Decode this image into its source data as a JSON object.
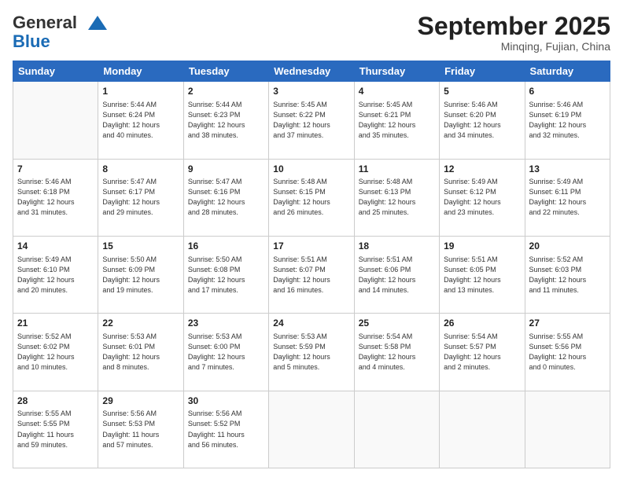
{
  "header": {
    "logo_line1": "General",
    "logo_line2": "Blue",
    "month": "September 2025",
    "location": "Minqing, Fujian, China"
  },
  "weekdays": [
    "Sunday",
    "Monday",
    "Tuesday",
    "Wednesday",
    "Thursday",
    "Friday",
    "Saturday"
  ],
  "weeks": [
    [
      {
        "day": "",
        "info": ""
      },
      {
        "day": "1",
        "info": "Sunrise: 5:44 AM\nSunset: 6:24 PM\nDaylight: 12 hours\nand 40 minutes."
      },
      {
        "day": "2",
        "info": "Sunrise: 5:44 AM\nSunset: 6:23 PM\nDaylight: 12 hours\nand 38 minutes."
      },
      {
        "day": "3",
        "info": "Sunrise: 5:45 AM\nSunset: 6:22 PM\nDaylight: 12 hours\nand 37 minutes."
      },
      {
        "day": "4",
        "info": "Sunrise: 5:45 AM\nSunset: 6:21 PM\nDaylight: 12 hours\nand 35 minutes."
      },
      {
        "day": "5",
        "info": "Sunrise: 5:46 AM\nSunset: 6:20 PM\nDaylight: 12 hours\nand 34 minutes."
      },
      {
        "day": "6",
        "info": "Sunrise: 5:46 AM\nSunset: 6:19 PM\nDaylight: 12 hours\nand 32 minutes."
      }
    ],
    [
      {
        "day": "7",
        "info": "Sunrise: 5:46 AM\nSunset: 6:18 PM\nDaylight: 12 hours\nand 31 minutes."
      },
      {
        "day": "8",
        "info": "Sunrise: 5:47 AM\nSunset: 6:17 PM\nDaylight: 12 hours\nand 29 minutes."
      },
      {
        "day": "9",
        "info": "Sunrise: 5:47 AM\nSunset: 6:16 PM\nDaylight: 12 hours\nand 28 minutes."
      },
      {
        "day": "10",
        "info": "Sunrise: 5:48 AM\nSunset: 6:15 PM\nDaylight: 12 hours\nand 26 minutes."
      },
      {
        "day": "11",
        "info": "Sunrise: 5:48 AM\nSunset: 6:13 PM\nDaylight: 12 hours\nand 25 minutes."
      },
      {
        "day": "12",
        "info": "Sunrise: 5:49 AM\nSunset: 6:12 PM\nDaylight: 12 hours\nand 23 minutes."
      },
      {
        "day": "13",
        "info": "Sunrise: 5:49 AM\nSunset: 6:11 PM\nDaylight: 12 hours\nand 22 minutes."
      }
    ],
    [
      {
        "day": "14",
        "info": "Sunrise: 5:49 AM\nSunset: 6:10 PM\nDaylight: 12 hours\nand 20 minutes."
      },
      {
        "day": "15",
        "info": "Sunrise: 5:50 AM\nSunset: 6:09 PM\nDaylight: 12 hours\nand 19 minutes."
      },
      {
        "day": "16",
        "info": "Sunrise: 5:50 AM\nSunset: 6:08 PM\nDaylight: 12 hours\nand 17 minutes."
      },
      {
        "day": "17",
        "info": "Sunrise: 5:51 AM\nSunset: 6:07 PM\nDaylight: 12 hours\nand 16 minutes."
      },
      {
        "day": "18",
        "info": "Sunrise: 5:51 AM\nSunset: 6:06 PM\nDaylight: 12 hours\nand 14 minutes."
      },
      {
        "day": "19",
        "info": "Sunrise: 5:51 AM\nSunset: 6:05 PM\nDaylight: 12 hours\nand 13 minutes."
      },
      {
        "day": "20",
        "info": "Sunrise: 5:52 AM\nSunset: 6:03 PM\nDaylight: 12 hours\nand 11 minutes."
      }
    ],
    [
      {
        "day": "21",
        "info": "Sunrise: 5:52 AM\nSunset: 6:02 PM\nDaylight: 12 hours\nand 10 minutes."
      },
      {
        "day": "22",
        "info": "Sunrise: 5:53 AM\nSunset: 6:01 PM\nDaylight: 12 hours\nand 8 minutes."
      },
      {
        "day": "23",
        "info": "Sunrise: 5:53 AM\nSunset: 6:00 PM\nDaylight: 12 hours\nand 7 minutes."
      },
      {
        "day": "24",
        "info": "Sunrise: 5:53 AM\nSunset: 5:59 PM\nDaylight: 12 hours\nand 5 minutes."
      },
      {
        "day": "25",
        "info": "Sunrise: 5:54 AM\nSunset: 5:58 PM\nDaylight: 12 hours\nand 4 minutes."
      },
      {
        "day": "26",
        "info": "Sunrise: 5:54 AM\nSunset: 5:57 PM\nDaylight: 12 hours\nand 2 minutes."
      },
      {
        "day": "27",
        "info": "Sunrise: 5:55 AM\nSunset: 5:56 PM\nDaylight: 12 hours\nand 0 minutes."
      }
    ],
    [
      {
        "day": "28",
        "info": "Sunrise: 5:55 AM\nSunset: 5:55 PM\nDaylight: 11 hours\nand 59 minutes."
      },
      {
        "day": "29",
        "info": "Sunrise: 5:56 AM\nSunset: 5:53 PM\nDaylight: 11 hours\nand 57 minutes."
      },
      {
        "day": "30",
        "info": "Sunrise: 5:56 AM\nSunset: 5:52 PM\nDaylight: 11 hours\nand 56 minutes."
      },
      {
        "day": "",
        "info": ""
      },
      {
        "day": "",
        "info": ""
      },
      {
        "day": "",
        "info": ""
      },
      {
        "day": "",
        "info": ""
      }
    ]
  ]
}
